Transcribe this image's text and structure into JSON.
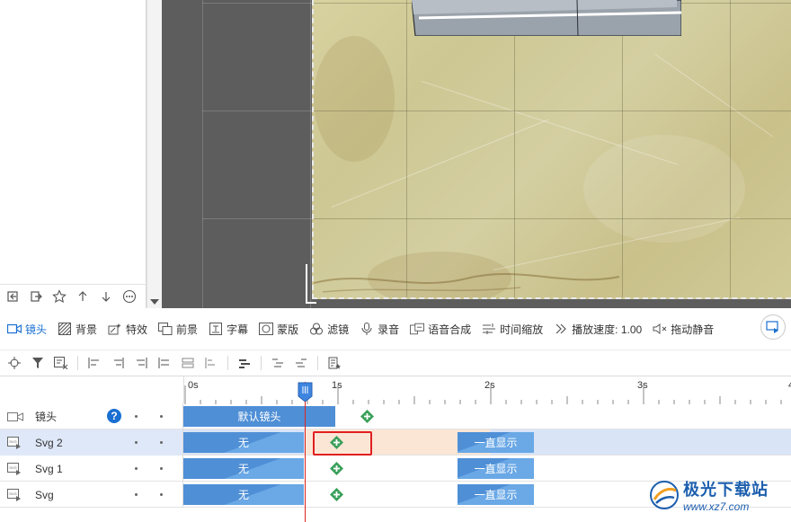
{
  "panel_toolbar": {
    "icons": [
      "import-icon",
      "export-icon",
      "star-icon",
      "arrow-up-icon",
      "arrow-down-icon",
      "more-icon"
    ]
  },
  "main_toolbar": {
    "items": [
      {
        "label": "镜头",
        "icon": "camera-icon",
        "active": true
      },
      {
        "label": "背景",
        "icon": "background-icon"
      },
      {
        "label": "特效",
        "icon": "effects-icon"
      },
      {
        "label": "前景",
        "icon": "foreground-icon"
      },
      {
        "label": "字幕",
        "icon": "subtitle-icon"
      },
      {
        "label": "蒙版",
        "icon": "mask-icon"
      },
      {
        "label": "滤镜",
        "icon": "filter-icon"
      },
      {
        "label": "录音",
        "icon": "microphone-icon"
      },
      {
        "label": "语音合成",
        "icon": "speech-synthesis-icon"
      },
      {
        "label": "时间缩放",
        "icon": "time-scale-icon"
      },
      {
        "label": "播放速度: 1.00",
        "icon": "play-speed-icon"
      },
      {
        "label": "拖动静音",
        "icon": "mute-icon"
      }
    ]
  },
  "ruler": {
    "labels": [
      "0s",
      "1s",
      "2s",
      "3s",
      "4"
    ]
  },
  "tracks": [
    {
      "name": "镜头",
      "icon": "camera-icon",
      "bar": "默认镜头",
      "has_help": true
    },
    {
      "name": "Svg 2",
      "icon": "svg-icon",
      "anim": "无",
      "always": "一直显示",
      "selected": true
    },
    {
      "name": "Svg 1",
      "icon": "svg-icon",
      "anim": "无",
      "always": "一直显示"
    },
    {
      "name": "Svg",
      "icon": "svg-icon",
      "anim": "无",
      "always": "一直显示"
    }
  ],
  "watermark": {
    "title": "极光下载站",
    "url": "www.xz7.com"
  },
  "colors": {
    "accent": "#1a6fd1",
    "bar": "#4f8fd6",
    "playhead": "#e0241e",
    "keyframe": "#3aa05a",
    "highlight": "#e02020"
  }
}
